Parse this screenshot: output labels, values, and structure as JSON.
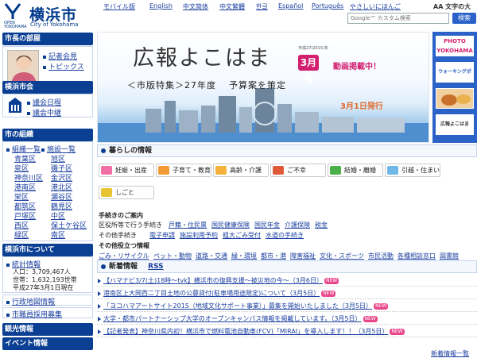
{
  "header": {
    "city_name": "横浜市",
    "city_en": "City of Yokohama",
    "logo_open": "OPEN",
    "logo_yokohama": "YOKOHAMA",
    "langs": [
      "モバイル版",
      "English",
      "中文简体",
      "中文繁體",
      "한글",
      "Español",
      "Português",
      "やさしいにほんご"
    ],
    "text_size": "AA 文字の大",
    "search_placeholder": "Google™ カスタム検索",
    "search_button": "検索"
  },
  "sidebar": {
    "mayor_head": "市長の部屋",
    "mayor_links": [
      "記者会見",
      "トピックス"
    ],
    "council_head": "横浜市会",
    "council_links": [
      "議会日程",
      "議会中継"
    ],
    "org_head": "市の組織",
    "org_links": [
      "組織一覧",
      "施設一覧"
    ],
    "wards": [
      "青葉区",
      "旭区",
      "泉区",
      "磯子区",
      "神奈川区",
      "金沢区",
      "港南区",
      "港北区",
      "栄区",
      "瀬谷区",
      "都筑区",
      "鶴見区",
      "戸塚区",
      "中区",
      "西区",
      "保土ケ谷区",
      "緑区",
      "南区"
    ],
    "about_head": "横浜市について",
    "stats_link": "統計情報",
    "stats_lines": [
      "人口：3,709,467人",
      "世帯：1,632,193世帯",
      "平成27年3月1日現在"
    ],
    "admin_link": "行政地図情報",
    "recruit_link": "市職員採用募集",
    "tourism_head": "観光情報",
    "event_head": "イベント情報"
  },
  "banner": {
    "title": "広報よこはま",
    "issue_date": "平成27(2015)年",
    "issue_num": "3月号",
    "new_label": "動画掲載中！",
    "subtitle": "＜市版特集＞27年度",
    "subtitle2": "予算案を策定",
    "release": "3月1日発行"
  },
  "thumbs": [
    "PHOTO YOKOHAMA",
    "ウォーキングポイント",
    "",
    "広報よこはま"
  ],
  "life": {
    "heading": "暮らしの情報",
    "buttons": [
      "妊娠・出産",
      "子育て・教育",
      "高齢・介護",
      "ご不幸",
      "結婚・離婚",
      "引越・住まい",
      "しごと"
    ],
    "proc_head": "手続きのご案内",
    "ward_proc": "区役所等で行う手続き",
    "ward_links": [
      "戸籍・住民票",
      "国民健康保険",
      "国民年金",
      "介護保険",
      "税金"
    ],
    "other_proc": "その他手続き",
    "other_links": [
      "電子申請",
      "施設利用予約",
      "粗大ごみ受付",
      "水道の手続き"
    ],
    "useful_head": "その他役立つ情報",
    "useful_links": [
      "ごみ・リサイクル",
      "ペット・動物",
      "道路・交通",
      "緑・環境",
      "都市・港",
      "障害福祉",
      "文化・スポーツ",
      "市民活動",
      "各種相談窓口",
      "図書館"
    ]
  },
  "news": {
    "heading": "新着情報",
    "rss": "RSS",
    "items": [
      {
        "text": "【ハマナビ3/7(土)18時〜tvk】横浜市の復興支援〜被災地の今〜（3月6日）",
        "new": "NEW"
      },
      {
        "text": "港南区上大岡西二丁目土地の公募貸付(駐車場用途限定)について（3月5日）",
        "new": "NEW"
      },
      {
        "text": "「ヨコハマアートサイト2015（地域文化サポート事業）」募集を開始いたしました（3月5日）",
        "new": "NEW"
      },
      {
        "text": "大学・都市パートナーシップ大学のオープンキャンパス情報を掲載しています。（3月5日）",
        "new": "NEW"
      },
      {
        "text": "【記者発表】神奈川県内初！横浜市で燃料電池自動車(FCV)「MIRAI」を導入します！！（3月5日）",
        "new": "NEW"
      }
    ],
    "more": "新着情報一覧"
  },
  "colors": {
    "navy": "#0b3f93",
    "pink": "#d21f6f",
    "link": "#1a3fa0"
  }
}
